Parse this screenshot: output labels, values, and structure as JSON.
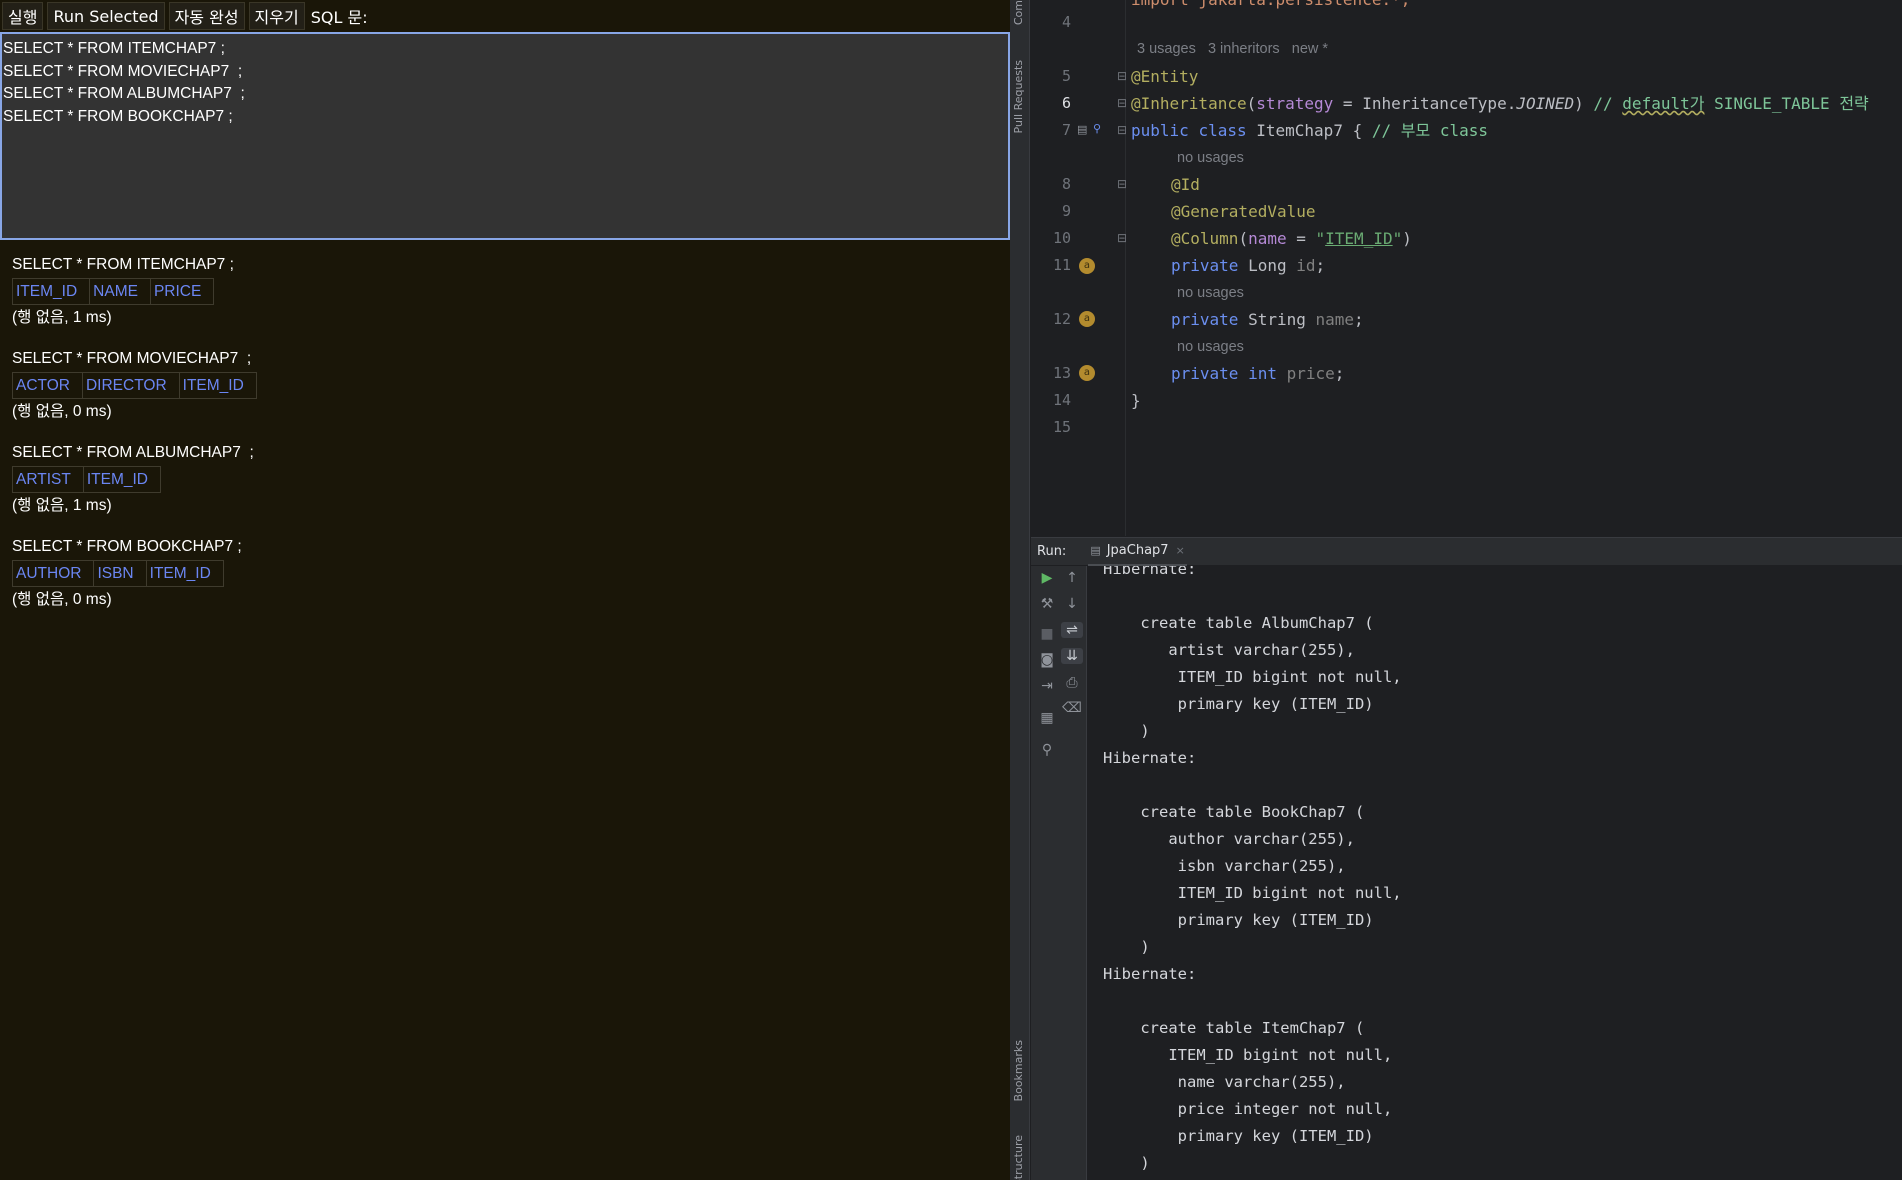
{
  "h2_console": {
    "toolbar": {
      "run": "실행",
      "run_selected": "Run Selected",
      "autocomplete": "자동 완성",
      "clear": "지우기",
      "sql_label": "SQL 문:"
    },
    "editor_lines": [
      "SELECT * FROM ITEMCHAP7 ;",
      "SELECT * FROM MOVIECHAP7  ;",
      "SELECT * FROM ALBUMCHAP7  ;",
      "SELECT * FROM BOOKCHAP7 ;"
    ],
    "results": [
      {
        "query": "SELECT * FROM ITEMCHAP7 ;",
        "columns": [
          "ITEM_ID",
          "NAME",
          "PRICE"
        ],
        "status": "(행 없음, 1 ms)"
      },
      {
        "query": "SELECT * FROM MOVIECHAP7  ;",
        "columns": [
          "ACTOR",
          "DIRECTOR",
          "ITEM_ID"
        ],
        "status": "(행 없음, 0 ms)"
      },
      {
        "query": "SELECT * FROM ALBUMCHAP7  ;",
        "columns": [
          "ARTIST",
          "ITEM_ID"
        ],
        "status": "(행 없음, 1 ms)"
      },
      {
        "query": "SELECT * FROM BOOKCHAP7 ;",
        "columns": [
          "AUTHOR",
          "ISBN",
          "ITEM_ID"
        ],
        "status": "(행 없음, 0 ms)"
      }
    ]
  },
  "ide": {
    "side_tabs": [
      "Com",
      "Pull Requests",
      "Bookmarks",
      "Structure"
    ],
    "line_numbers": [
      "4",
      "5",
      "6",
      "7",
      "8",
      "9",
      "10",
      "11",
      "12",
      "13",
      "14",
      "15"
    ],
    "hints": {
      "usages": "3 usages",
      "inheritors": "3 inheritors",
      "new": "new *",
      "no_usages": "no usages"
    },
    "code": {
      "line4": "import jakarta.persistence.*;",
      "entity_at": "@",
      "entity_name": "Entity",
      "inheritance_ann": "@Inheritance",
      "strategy_param": "strategy",
      "equals": " = ",
      "inheritance_type": "InheritanceType.",
      "joined": "JOINED",
      "comment_slashes": "// ",
      "comment_default": "default가",
      "comment_rest": " SINGLE_TABLE 전략",
      "public_kw": "public",
      "class_kw": "class",
      "class_name": "ItemChap7 {",
      "class_comment": "// 부모 class",
      "id_ann": "@Id",
      "gen_ann": "@GeneratedValue",
      "column_ann": "@Column",
      "name_param": "name",
      "column_value": "ITEM_ID",
      "private_kw": "private",
      "long_type": "Long",
      "id_field": "id",
      "string_type": "String",
      "name_field": "name",
      "int_kw": "int",
      "price_field": "price",
      "close_brace": "}"
    },
    "run_panel": {
      "label": "Run:",
      "tab": "JpaChap7",
      "close": "×"
    },
    "console_lines": [
      "Hibernate: ",
      "",
      "    create table AlbumChap7 (",
      "       artist varchar(255),",
      "        ITEM_ID bigint not null,",
      "        primary key (ITEM_ID)",
      "    )",
      "Hibernate: ",
      "",
      "    create table BookChap7 (",
      "       author varchar(255),",
      "        isbn varchar(255),",
      "        ITEM_ID bigint not null,",
      "        primary key (ITEM_ID)",
      "    )",
      "Hibernate: ",
      "",
      "    create table ItemChap7 (",
      "       ITEM_ID bigint not null,",
      "        name varchar(255),",
      "        price integer not null,",
      "        primary key (ITEM_ID)",
      "    )"
    ],
    "colors": {
      "keyword": "#6b8ff0",
      "annotation": "#b3ae60",
      "string": "#6aab73",
      "comment": "#7ec699",
      "h2_link": "#6b86f2"
    }
  }
}
